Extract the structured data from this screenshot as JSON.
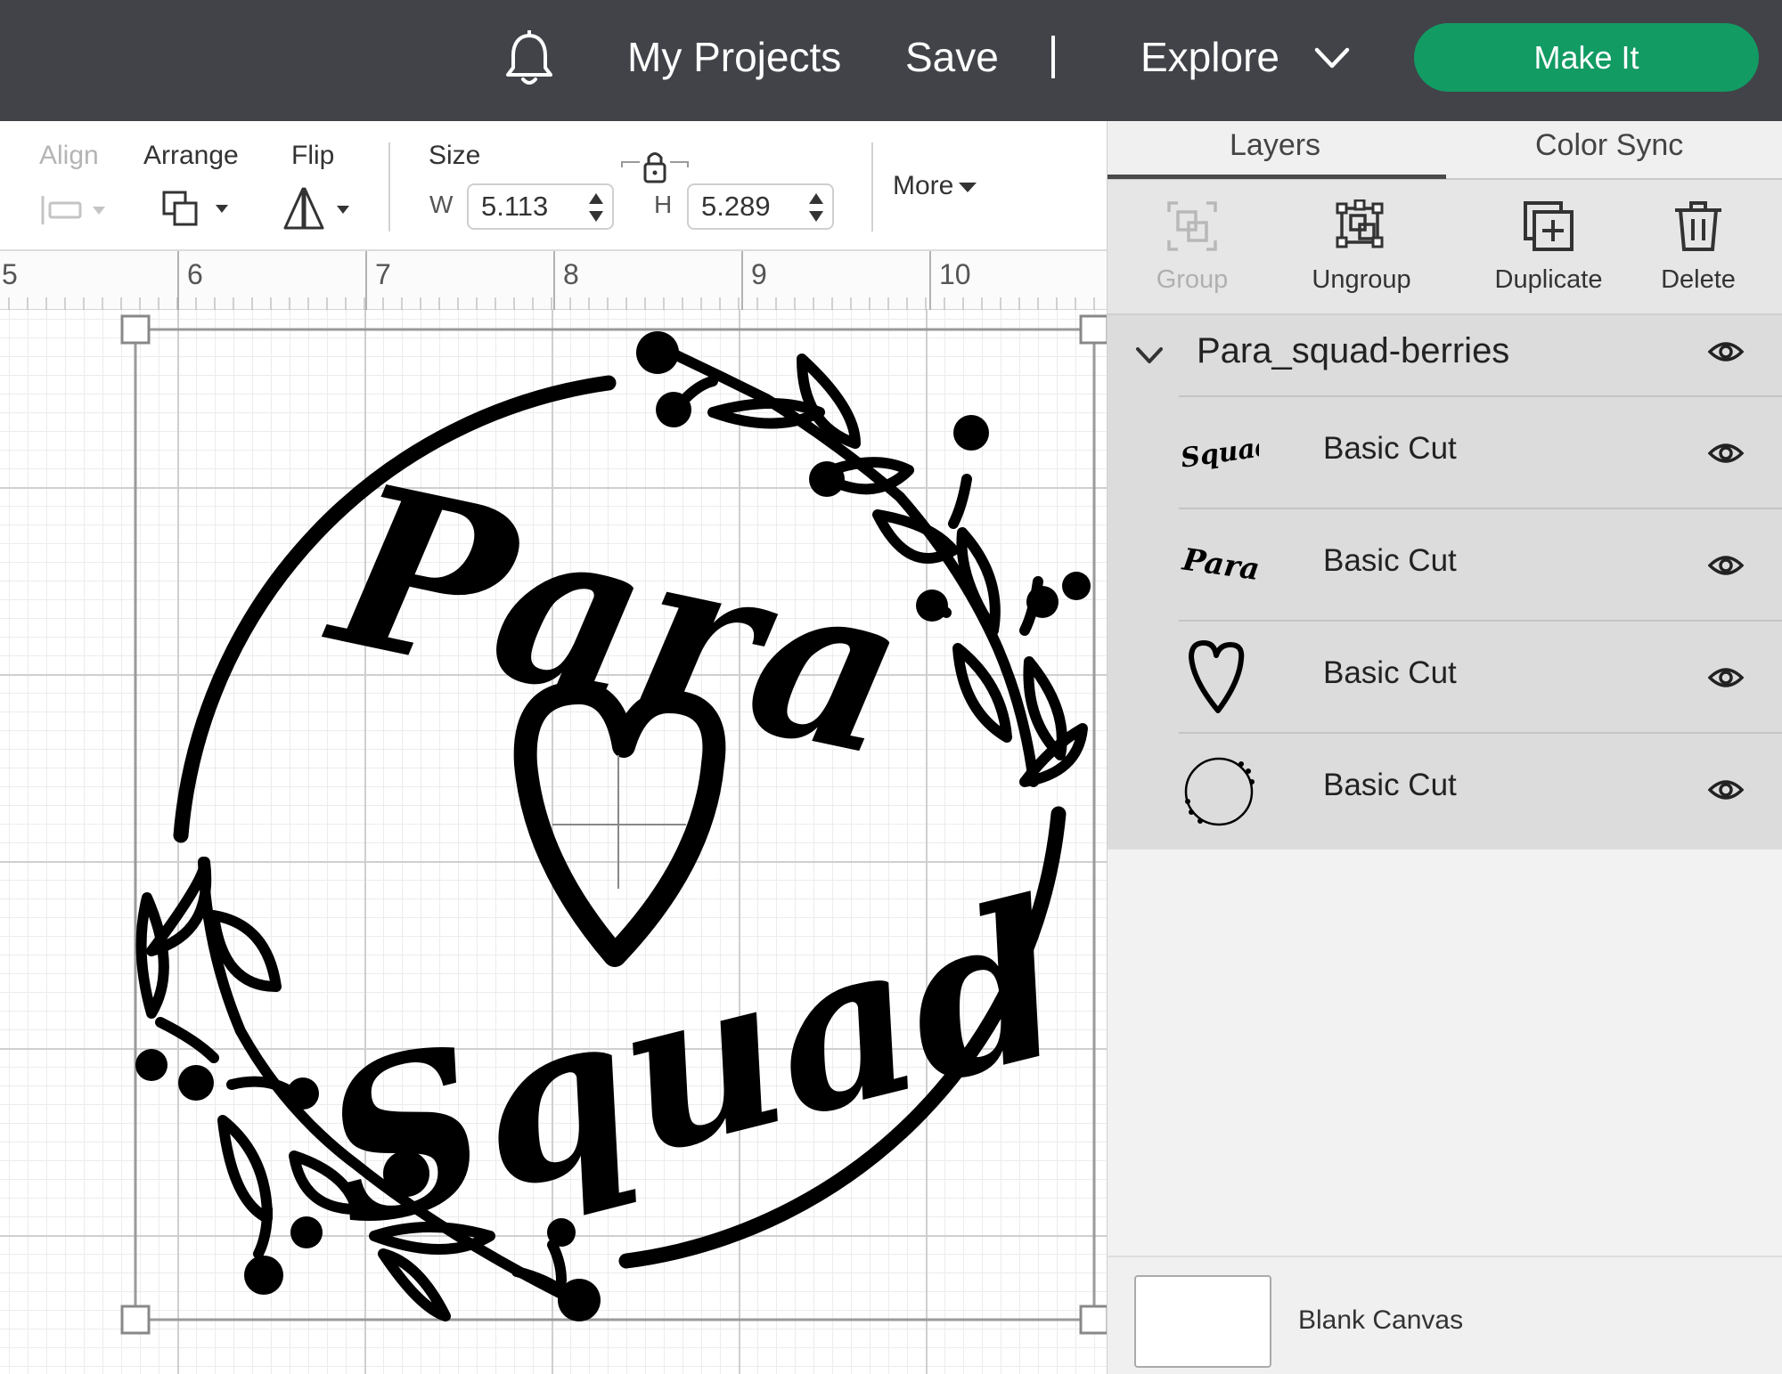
{
  "header": {
    "my_projects": "My Projects",
    "save": "Save",
    "divider": "|",
    "explore": "Explore",
    "make_it": "Make It",
    "make_it_color": "#129b63",
    "icons": [
      "bell-icon",
      "chevron-down-icon"
    ]
  },
  "toolbar": {
    "align": "Align",
    "arrange": "Arrange",
    "flip": "Flip",
    "size": "Size",
    "w_label": "W",
    "h_label": "H",
    "width": "5.113",
    "height": "5.289",
    "more": "More",
    "size_locked": true
  },
  "ruler": {
    "marks": [
      "5",
      "6",
      "7",
      "8",
      "9",
      "10"
    ]
  },
  "panel": {
    "tabs": [
      "Layers",
      "Color Sync"
    ],
    "active_tab": "Layers",
    "actions": [
      {
        "label": "Group",
        "enabled": false,
        "icon": "group-icon"
      },
      {
        "label": "Ungroup",
        "enabled": true,
        "icon": "ungroup-icon"
      },
      {
        "label": "Duplicate",
        "enabled": true,
        "icon": "duplicate-icon"
      },
      {
        "label": "Delete",
        "enabled": true,
        "icon": "trash-icon"
      }
    ],
    "group_name": "Para_squad-berries",
    "layers": [
      {
        "name": "Basic Cut",
        "thumb": "squad-text",
        "visible": true
      },
      {
        "name": "Basic Cut",
        "thumb": "para-text",
        "visible": true
      },
      {
        "name": "Basic Cut",
        "thumb": "heart",
        "visible": true
      },
      {
        "name": "Basic Cut",
        "thumb": "wreath-circle",
        "visible": true
      }
    ],
    "canvas_label": "Blank Canvas"
  },
  "design": {
    "line1": "Para",
    "line2": "Squad",
    "ink_color": "#000000"
  }
}
